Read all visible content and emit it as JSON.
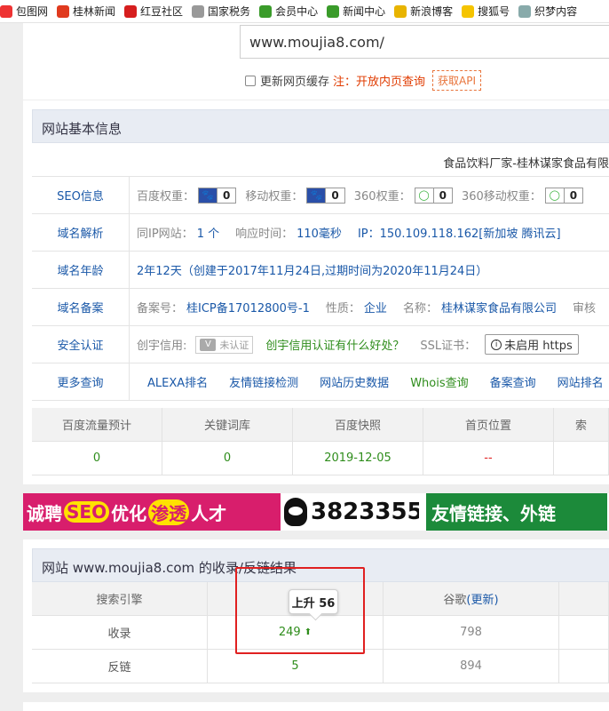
{
  "bookmarks": [
    {
      "label": "包图网",
      "icon": "baotu-icon",
      "color": "#e33"
    },
    {
      "label": "桂林新闻",
      "icon": "guilin-news-icon",
      "color": "#e03a1e"
    },
    {
      "label": "红豆社区",
      "icon": "hongdou-icon",
      "color": "#d61e1e"
    },
    {
      "label": "国家税务",
      "icon": "page-icon",
      "color": "#999"
    },
    {
      "label": "会员中心",
      "icon": "leaf-icon",
      "color": "#3a9b2a"
    },
    {
      "label": "新闻中心",
      "icon": "leaf-icon",
      "color": "#3a9b2a"
    },
    {
      "label": "新浪博客",
      "icon": "sina-icon",
      "color": "#e8b400"
    },
    {
      "label": "搜狐号",
      "icon": "sohu-icon",
      "color": "#f5c400"
    },
    {
      "label": "织梦内容",
      "icon": "dede-icon",
      "color": "#8aa"
    }
  ],
  "search": {
    "url": "www.moujia8.com/",
    "refresh_label": "更新网页缓存",
    "note": "注：开放内页查询",
    "api_button": "获取API"
  },
  "basic": {
    "title": "网站基本信息",
    "company": "食品饮料厂家-桂林谋家食品有限",
    "seo": {
      "label": "SEO信息",
      "weights": [
        {
          "key": "百度权重：",
          "value": "0",
          "icon": "baidu-paw-icon"
        },
        {
          "key": "移动权重：",
          "value": "0",
          "icon": "baidu-paw-icon"
        },
        {
          "key": "360权重：",
          "value": "0",
          "icon": "360-ring-icon"
        },
        {
          "key": "360移动权重：",
          "value": "0",
          "icon": "360-ring-icon"
        }
      ]
    },
    "dns": {
      "label": "域名解析",
      "same_ip_key": "同IP网站：",
      "same_ip_value": "1 个",
      "resp_key": "响应时间：",
      "resp_value": "110毫秒",
      "ip": "IP：150.109.118.162[新加坡 腾讯云]"
    },
    "age": {
      "label": "域名年龄",
      "value": "2年12天（创建于2017年11月24日,过期时间为2020年11月24日）"
    },
    "icp": {
      "label": "域名备案",
      "no_key": "备案号：",
      "no_value": "桂ICP备17012800号-1",
      "type_key": "性质：",
      "type_value": "企业",
      "name_key": "名称：",
      "name_value": "桂林谋家食品有限公司",
      "extra_key": "审核"
    },
    "security": {
      "label": "安全认证",
      "credit_key": "创宇信用:",
      "uncert_label": "未认证",
      "credit_link": "创宇信用认证有什么好处？",
      "ssl_key": "SSL证书：",
      "ssl_value": "未启用 https"
    },
    "more": {
      "label": "更多查询",
      "links": [
        "ALEXA排名",
        "友情链接检测",
        "网站历史数据",
        "Whois查询",
        "备案查询",
        "网站排名"
      ]
    },
    "stats": {
      "headers": [
        "百度流量预计",
        "关键词库",
        "百度快照",
        "首页位置",
        "索"
      ],
      "values": [
        "0",
        "0",
        "2019-12-05",
        "--",
        ""
      ]
    }
  },
  "banner": {
    "part1_a": "诚聘",
    "part1_seo": "SEO",
    "part1_b": "优化",
    "part1_c": "渗透",
    "part1_d": "人才",
    "qq": "3823355",
    "part3": "友情链接、外链"
  },
  "backlinks": {
    "title": "网站 www.moujia8.com 的收录/反链结果",
    "headers": [
      "搜索引擎",
      "百",
      "谷歌",
      ""
    ],
    "google_update": "(更新)",
    "rows": [
      {
        "name": "收录",
        "baidu": "249",
        "google": "798",
        "extra": ""
      },
      {
        "name": "反链",
        "baidu": "5",
        "google": "894",
        "extra": ""
      }
    ],
    "tooltip": "上升 56"
  }
}
